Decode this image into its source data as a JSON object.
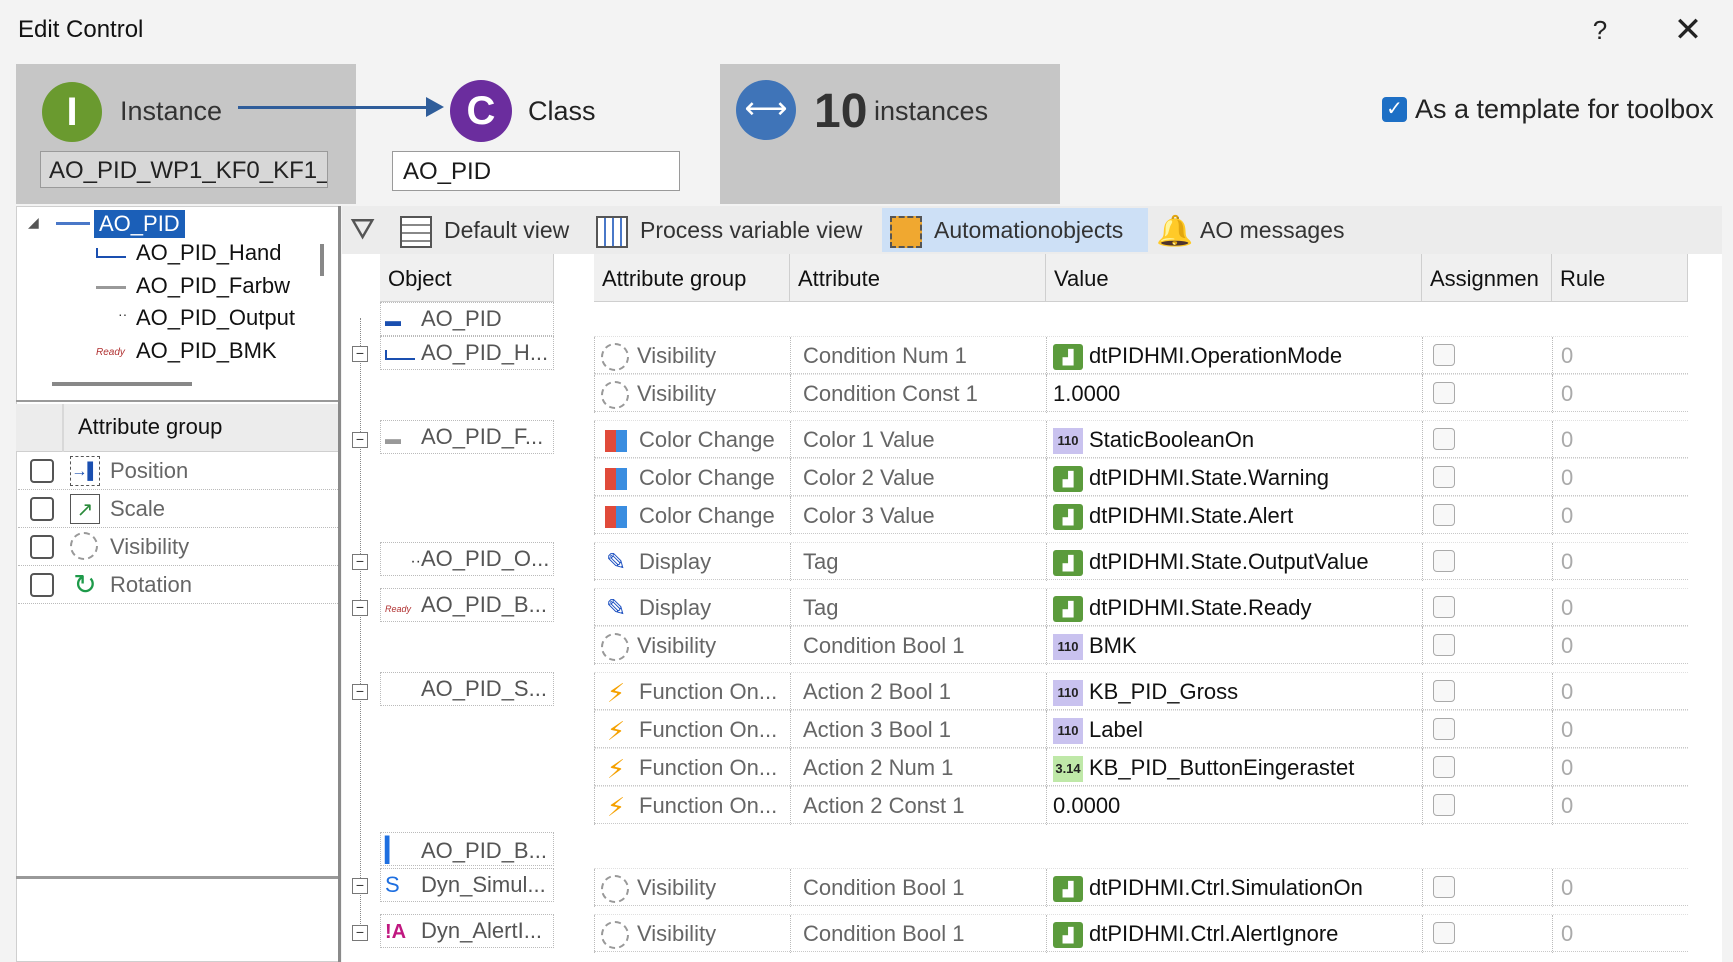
{
  "window": {
    "title": "Edit Control",
    "help": "?",
    "close": "✕"
  },
  "header": {
    "instance_label": "Instance",
    "instance_value": "AO_PID_WP1_KF0_KF1_",
    "class_label": "Class",
    "class_value": "AO_PID",
    "instances_count": "10",
    "instances_label": "instances",
    "template_checkbox_label": "As a template for toolbox",
    "template_checked": true
  },
  "tree": {
    "root": "AO_PID",
    "children": [
      "AO_PID_Hand",
      "AO_PID_Farbw",
      "AO_PID_Output",
      "AO_PID_BMK"
    ]
  },
  "attribute_groups": {
    "title": "Attribute group",
    "items": [
      "Position",
      "Scale",
      "Visibility",
      "Rotation"
    ]
  },
  "toolbar": {
    "default_view": "Default view",
    "process_variable_view": "Process variable view",
    "automationobjects": "Automationobjects",
    "ao_messages": "AO messages"
  },
  "grid": {
    "columns": [
      "Object",
      "Attribute group",
      "Attribute",
      "Value",
      "Assignmen",
      "Rule"
    ],
    "objects": [
      "AO_PID",
      "AO_PID_H...",
      "AO_PID_F...",
      "AO_PID_O...",
      "AO_PID_B...",
      "AO_PID_S...",
      "AO_PID_B...",
      "Dyn_Simul...",
      "Dyn_AlertI..."
    ],
    "rows": [
      {
        "group": "Visibility",
        "attribute": "Condition Num 1",
        "value": "dtPIDHMI.OperationMode",
        "rule": "0"
      },
      {
        "group": "Visibility",
        "attribute": "Condition Const 1",
        "value": "1.0000",
        "rule": "0"
      },
      {
        "group": "Color Change",
        "attribute": "Color 1 Value",
        "value": "StaticBooleanOn",
        "rule": "0"
      },
      {
        "group": "Color Change",
        "attribute": "Color 2 Value",
        "value": "dtPIDHMI.State.Warning",
        "rule": "0"
      },
      {
        "group": "Color Change",
        "attribute": "Color 3 Value",
        "value": "dtPIDHMI.State.Alert",
        "rule": "0"
      },
      {
        "group": "Display",
        "attribute": "Tag",
        "value": "dtPIDHMI.State.OutputValue",
        "rule": "0"
      },
      {
        "group": "Display",
        "attribute": "Tag",
        "value": "dtPIDHMI.State.Ready",
        "rule": "0"
      },
      {
        "group": "Visibility",
        "attribute": "Condition Bool 1",
        "value": "BMK",
        "rule": "0"
      },
      {
        "group": "Function On...",
        "attribute": "Action 2 Bool 1",
        "value": "KB_PID_Gross",
        "rule": "0"
      },
      {
        "group": "Function On...",
        "attribute": "Action 3 Bool 1",
        "value": "Label",
        "rule": "0"
      },
      {
        "group": "Function On...",
        "attribute": "Action 2 Num 1",
        "value": "KB_PID_ButtonEingerastet",
        "rule": "0"
      },
      {
        "group": "Function On...",
        "attribute": "Action 2 Const 1",
        "value": "0.0000",
        "rule": "0"
      },
      {
        "group": "Visibility",
        "attribute": "Condition Bool 1",
        "value": "dtPIDHMI.Ctrl.SimulationOn",
        "rule": "0"
      },
      {
        "group": "Visibility",
        "attribute": "Condition Bool 1",
        "value": "dtPIDHMI.Ctrl.AlertIgnore",
        "rule": "0"
      }
    ]
  },
  "icons": {
    "type_bool": "110",
    "type_num": "3.14",
    "object_s": "S",
    "object_alert": "!A",
    "label_ready": "Ready"
  },
  "colors": {
    "accent": "#1b5fb8",
    "instance": "#6a9a2f",
    "class": "#6b2d9e",
    "instances": "#3f74b8",
    "header_bg": "#c6c6c6"
  }
}
